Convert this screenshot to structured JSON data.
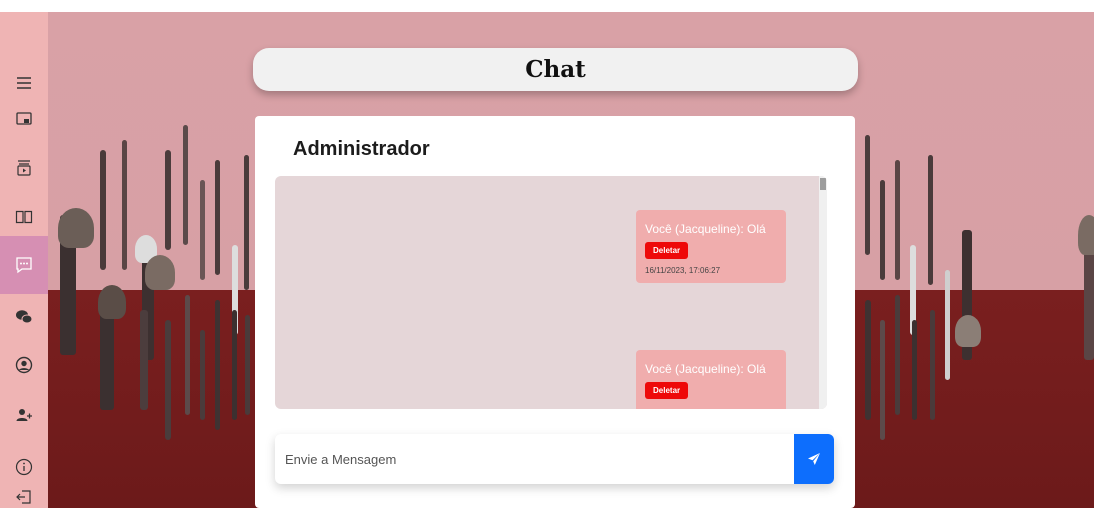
{
  "colors": {
    "sidebar_bg": "#efb4b4",
    "sidebar_active": "#d68fb3",
    "bubble_bg": "#f0adad",
    "delete_button": "#ee0909",
    "send_button": "#0d6efd",
    "messages_bg": "#e5d6d8"
  },
  "sidebar": {
    "items": [
      {
        "icon": "menu-icon"
      },
      {
        "icon": "monitor-icon"
      },
      {
        "icon": "video-icon"
      },
      {
        "icon": "book-icon"
      },
      {
        "icon": "chat-icon",
        "active": true
      },
      {
        "icon": "wechat-icon"
      },
      {
        "icon": "user-circle-icon"
      },
      {
        "icon": "users-icon"
      },
      {
        "icon": "info-icon"
      },
      {
        "icon": "logout-icon"
      }
    ]
  },
  "header": {
    "title": "Chat"
  },
  "chat": {
    "contact_name": "Administrador",
    "messages": [
      {
        "text": "Você (Jacqueline): Olá",
        "delete_label": "Deletar",
        "timestamp": "16/11/2023, 17:06:27"
      },
      {
        "text": "Você (Jacqueline): Olá",
        "delete_label": "Deletar"
      }
    ],
    "input": {
      "placeholder": "Envie a Mensagem",
      "value": ""
    },
    "send_icon": "paper-plane-icon"
  }
}
